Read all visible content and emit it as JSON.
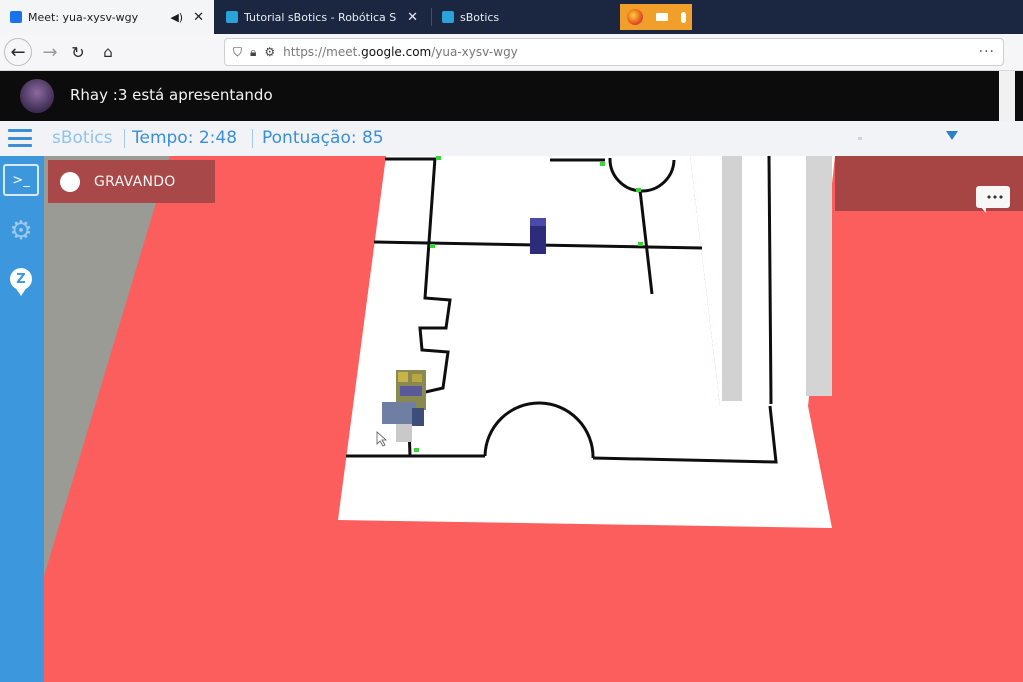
{
  "browser": {
    "tabs": [
      {
        "label": "Meet: yua-xysv-wgy",
        "active": true,
        "favicon_color": "#1a73e8"
      },
      {
        "label": "Tutorial sBotics - Robótica Sim",
        "active": false,
        "favicon_color": "#2aa3d8"
      },
      {
        "label": "sBotics",
        "active": false,
        "favicon_color": "#2aa3d8"
      }
    ],
    "url_prefix": "https://meet.",
    "url_domain": "google.com",
    "url_path": "/yua-xysv-wgy",
    "more_label": "···"
  },
  "meet": {
    "presenter_text": "Rhay :3 está apresentando"
  },
  "sbotics": {
    "brand": "sBotics",
    "time": "Tempo: 2:48",
    "score": "Pontuação: 85",
    "recording_label": "GRAVANDO",
    "terminal_icon_label": ">_",
    "badge_icon_label": "Z"
  },
  "colors": {
    "floor": "#fc5e5e",
    "arena": "#ffffff",
    "track": "#0e0e0e",
    "marker": "#39d639",
    "sidebar": "#3d97dc",
    "recording": "#a94848"
  },
  "icons": [
    "back-arrow-icon",
    "forward-arrow-icon",
    "reload-icon",
    "home-icon",
    "shield-icon",
    "lock-icon",
    "permissions-icon",
    "camera-icon",
    "menu-icon",
    "terminal-icon",
    "gear-icon",
    "badge-icon",
    "chat-icon",
    "dropdown-caret-icon"
  ]
}
